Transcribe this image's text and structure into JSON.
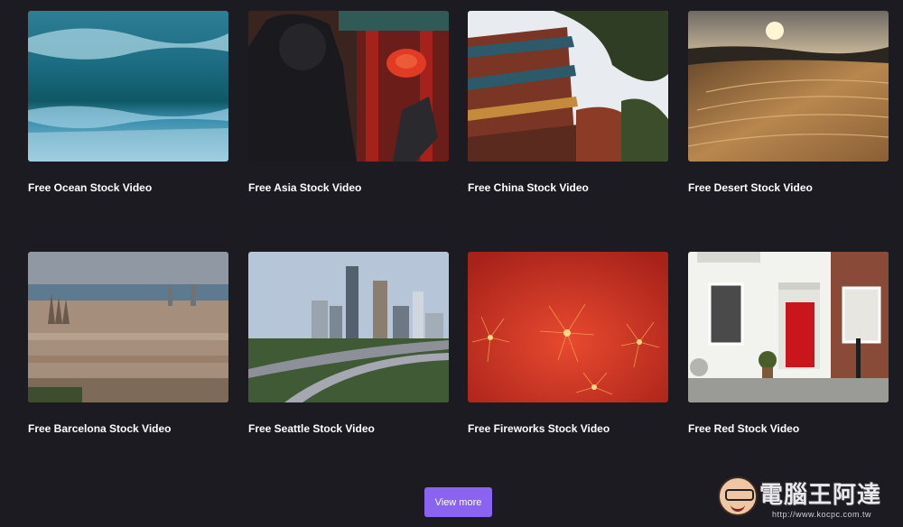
{
  "cards": [
    {
      "title": "Free Ocean Stock Video"
    },
    {
      "title": "Free Asia Stock Video"
    },
    {
      "title": "Free China Stock Video"
    },
    {
      "title": "Free Desert Stock Video"
    },
    {
      "title": "Free Barcelona Stock Video"
    },
    {
      "title": "Free Seattle Stock Video"
    },
    {
      "title": "Free Fireworks Stock Video"
    },
    {
      "title": "Free Red Stock Video"
    }
  ],
  "view_more_label": "View more",
  "watermark": {
    "title": "電腦王阿達",
    "url": "http://www.kocpc.com.tw"
  },
  "colors": {
    "background": "#1c1b22",
    "button": "#8a63f0",
    "text": "#ffffff"
  }
}
